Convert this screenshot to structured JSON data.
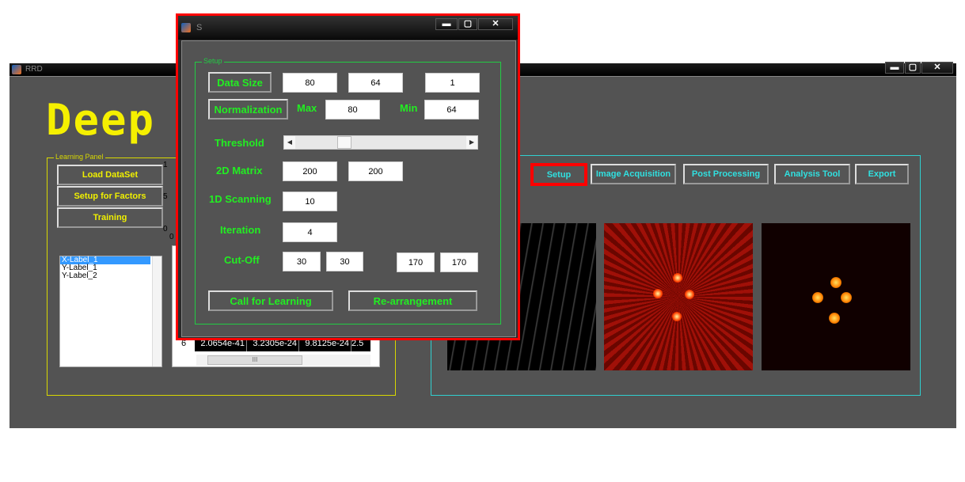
{
  "main_window": {
    "title": "RRD",
    "logo_text": "Deep i",
    "controls": {
      "minimize": "▬",
      "maximize": "▢",
      "close": "✕"
    },
    "learning_panel": {
      "label": "Learning Panel",
      "buttons": [
        "Load DataSet",
        "Setup for Factors",
        "Training"
      ],
      "list_items": [
        "X-Label_1",
        "Y-Label_1",
        "Y-Label_2"
      ],
      "selected_item": "X-Label_1",
      "axis_ticks": [
        "1",
        "5",
        "0",
        "0"
      ],
      "table": {
        "row_header": "6",
        "cells": [
          "2.0654e-41",
          "3.2305e-24",
          "9.8125e-24",
          "2.5"
        ],
        "scroll_glyph": "III"
      }
    },
    "toolbar": {
      "buttons": [
        "Setup",
        "Image Acquisition",
        "Post Processing",
        "Analysis Tool",
        "Export"
      ],
      "highlighted": "Setup"
    }
  },
  "setup_dialog": {
    "title": "S",
    "controls": {
      "minimize": "▬",
      "maximize": "▢",
      "close": "✕"
    },
    "group_label": "Setup",
    "data_size": {
      "label": "Data Size",
      "values": [
        "80",
        "64",
        "1"
      ]
    },
    "normalization": {
      "label": "Normalization",
      "max_label": "Max",
      "max": "80",
      "min_label": "Min",
      "min": "64"
    },
    "threshold": {
      "label": "Threshold",
      "value_fraction": 0.27
    },
    "matrix_2d": {
      "label": "2D Matrix",
      "values": [
        "200",
        "200"
      ]
    },
    "scanning_1d": {
      "label": "1D Scanning",
      "value": "10"
    },
    "iteration": {
      "label": "Iteration",
      "value": "4"
    },
    "cut_off": {
      "label": "Cut-Off",
      "values": [
        "30",
        "30",
        "170",
        "170"
      ]
    },
    "buttons": {
      "call_for_learning": "Call for Learning",
      "rearrangement": "Re-arrangement"
    }
  },
  "colors": {
    "background": "#535353",
    "learning_accent": "#f0f000",
    "tool_accent": "#30e0e0",
    "setup_accent": "#22ee22",
    "highlight": "#ff0000"
  }
}
